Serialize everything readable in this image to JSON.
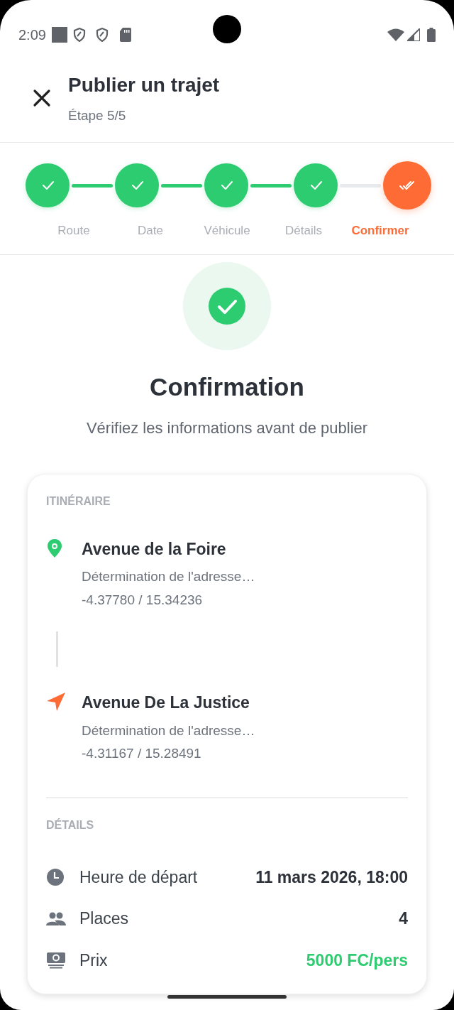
{
  "status_bar": {
    "time": "2:09"
  },
  "header": {
    "title": "Publier un trajet",
    "subtitle": "Étape 5/5"
  },
  "steps": [
    {
      "label": "Route",
      "done": true,
      "selected": false
    },
    {
      "label": "Date",
      "done": true,
      "selected": false
    },
    {
      "label": "Véhicule",
      "done": true,
      "selected": false
    },
    {
      "label": "Détails",
      "done": true,
      "selected": false
    },
    {
      "label": "Confirmer",
      "done": false,
      "selected": true
    }
  ],
  "hero": {
    "title": "Confirmation",
    "subtitle": "Vérifiez les informations avant de publier"
  },
  "itinerary": {
    "heading": "ITINÉRAIRE",
    "stops": [
      {
        "kind": "origin",
        "name": "Avenue de la Foire",
        "address": "Détermination de l'adresse…",
        "coords": "-4.37780 / 15.34236"
      },
      {
        "kind": "destination",
        "name": "Avenue De La Justice",
        "address": "Détermination de l'adresse…",
        "coords": "-4.31167 / 15.28491"
      }
    ]
  },
  "details": {
    "heading": "DÉTAILS",
    "rows": [
      {
        "kind": "time",
        "label": "Heure de départ",
        "value": "11 mars 2026, 18:00"
      },
      {
        "kind": "seats",
        "label": "Places",
        "value": "4"
      },
      {
        "kind": "price",
        "label": "Prix",
        "value": "5000 FC/pers"
      }
    ]
  }
}
